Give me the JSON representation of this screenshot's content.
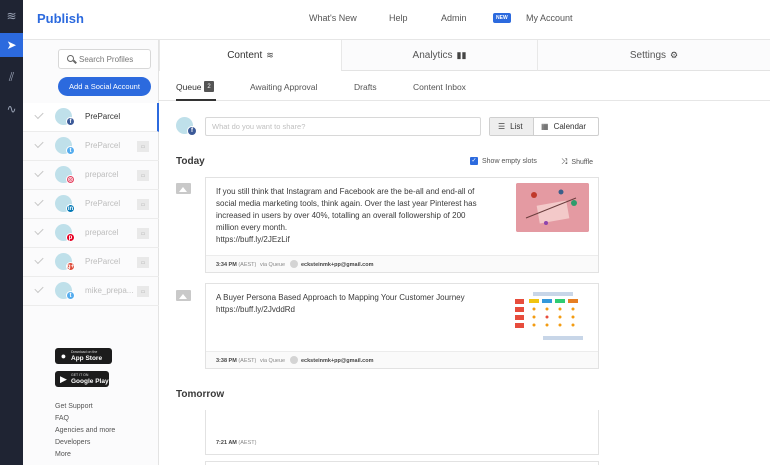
{
  "app": {
    "title": "Publish"
  },
  "header": {
    "nav": [
      "What's New",
      "Help",
      "Admin",
      "My Account"
    ],
    "admin_badge": "NEW"
  },
  "sidebar": {
    "search_placeholder": "Search Profiles",
    "add_button": "Add a Social Account",
    "profiles": [
      {
        "name": "PreParcel",
        "network": "facebook",
        "net_color": "#3b5998",
        "net_glyph": "f",
        "active": true
      },
      {
        "name": "PreParcel",
        "network": "twitter",
        "net_color": "#55acee",
        "net_glyph": "t",
        "active": false
      },
      {
        "name": "preparcel",
        "network": "instagram",
        "net_color": "#e4405f",
        "net_glyph": "◎",
        "active": false
      },
      {
        "name": "PreParcel",
        "network": "linkedin",
        "net_color": "#0077b5",
        "net_glyph": "in",
        "active": false
      },
      {
        "name": "preparcel",
        "network": "pinterest",
        "net_color": "#e60023",
        "net_glyph": "p",
        "active": false
      },
      {
        "name": "PreParcel",
        "network": "google-plus",
        "net_color": "#dd4b39",
        "net_glyph": "g+",
        "active": false
      },
      {
        "name": "mike_prepa...",
        "network": "twitter",
        "net_color": "#55acee",
        "net_glyph": "t",
        "active": false
      }
    ],
    "app_store": {
      "line1": "Download on the",
      "line2": "App Store"
    },
    "google_play": {
      "line1": "GET IT ON",
      "line2": "Google Play"
    },
    "links": [
      "Get Support",
      "FAQ",
      "Agencies and more",
      "Developers",
      "More"
    ]
  },
  "tabs": [
    {
      "label": "Content",
      "icon": "layers-icon"
    },
    {
      "label": "Analytics",
      "icon": "bar-chart-icon"
    },
    {
      "label": "Settings",
      "icon": "gear-icon"
    }
  ],
  "subtabs": {
    "queue": "Queue",
    "queue_count": "2",
    "awaiting": "Awaiting Approval",
    "drafts": "Drafts",
    "inbox": "Content Inbox"
  },
  "composer": {
    "placeholder": "What do you want to share?"
  },
  "view": {
    "list": "List",
    "calendar": "Calendar"
  },
  "today": {
    "heading": "Today",
    "show_empty": "Show empty slots",
    "shuffle": "Shuffle"
  },
  "posts": [
    {
      "lines": [
        "If you still think that Instagram and Facebook are the be-all and end-all of",
        "social media marketing tools, think again. Over the last year Pinterest has",
        "increased in users by over 40%, totalling an overall followership of 200",
        "million every month.",
        "https://buff.ly/2JEzLif"
      ],
      "time": "3:34 PM",
      "tz": "(AEST)",
      "via": "via Queue",
      "user": "ecksteinmk+pp@gmail.com"
    },
    {
      "lines": [
        "A Buyer Persona Based Approach to Mapping Your Customer Journey",
        "https://buff.ly/2JvddRd"
      ],
      "time": "3:38 PM",
      "tz": "(AEST)",
      "via": "via Queue",
      "user": "ecksteinmk+pp@gmail.com"
    }
  ],
  "tomorrow": {
    "heading": "Tomorrow",
    "slot_time": "7:21 AM",
    "slot_tz": "(AEST)"
  }
}
